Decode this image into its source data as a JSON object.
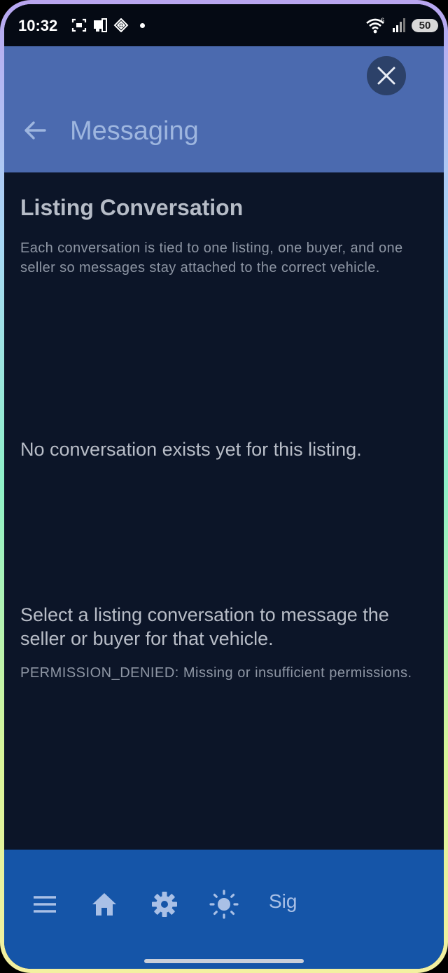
{
  "status_bar": {
    "time": "10:32",
    "battery": "50",
    "wifi_badge": "6"
  },
  "app_bar": {
    "title": "Messaging"
  },
  "content": {
    "heading": "Listing Conversation",
    "description": "Each conversation is tied to one listing, one buyer, and one seller so messages stay attached to the correct vehicle.",
    "empty_message": "No conversation exists yet for this listing.",
    "select_message": "Select a listing conversation to message the seller or buyer for that vehicle.",
    "error_message": "PERMISSION_DENIED: Missing or insufficient permissions."
  },
  "bottom_nav": {
    "items": [
      {
        "icon": "menu-icon"
      },
      {
        "icon": "home-icon"
      },
      {
        "icon": "settings-icon"
      },
      {
        "icon": "brightness-icon"
      }
    ],
    "sig_label": "Sig"
  },
  "colors": {
    "app_bar": "#4b6aaf",
    "background": "#0c1528",
    "bottom_bar": "#1555a8",
    "close_button": "#2c4169"
  }
}
